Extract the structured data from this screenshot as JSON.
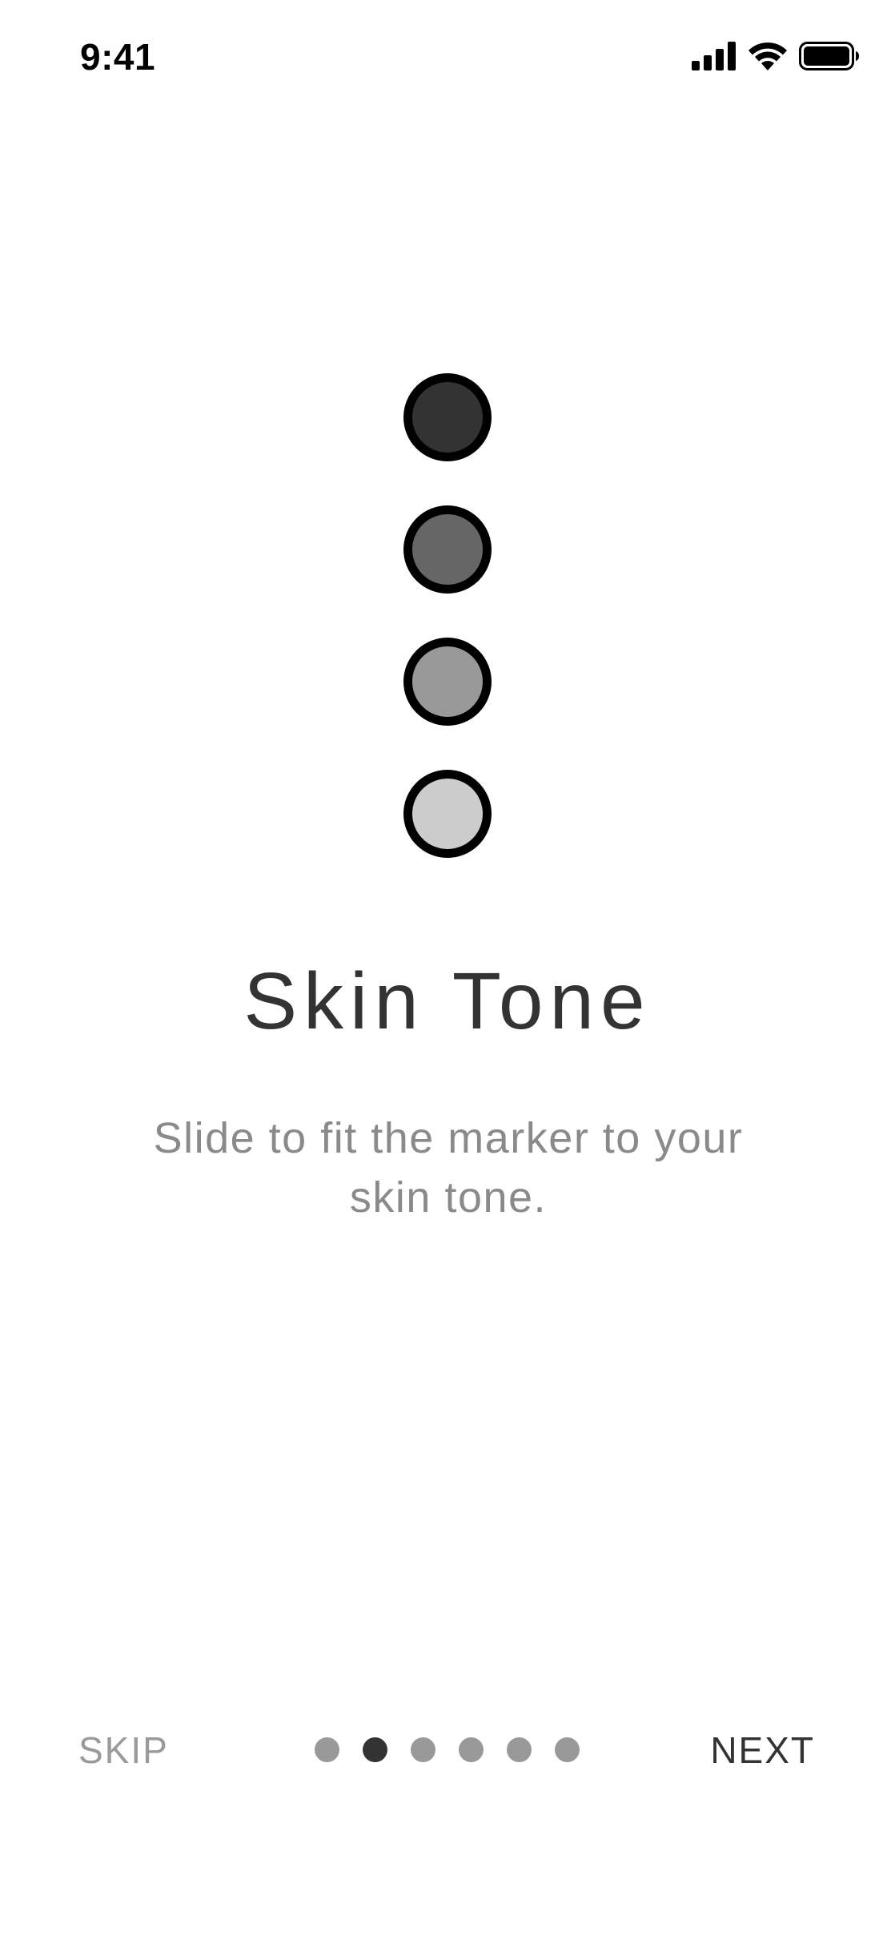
{
  "status_bar": {
    "time": "9:41",
    "icons": [
      "cellular-signal-icon",
      "wifi-icon",
      "battery-icon"
    ]
  },
  "tones": [
    {
      "name": "tone-1",
      "color": "#333333"
    },
    {
      "name": "tone-2",
      "color": "#666666"
    },
    {
      "name": "tone-3",
      "color": "#999999"
    },
    {
      "name": "tone-4",
      "color": "#cccccc"
    }
  ],
  "content": {
    "title": "Skin Tone",
    "subtitle": "Slide to fit the marker to your skin tone."
  },
  "navigation": {
    "skip_label": "SKIP",
    "next_label": "NEXT",
    "page_count": 6,
    "active_page": 2
  },
  "colors": {
    "text_dark": "#333333",
    "text_muted": "#8a8a8a",
    "dot_inactive": "#999999",
    "dot_active": "#333333",
    "swatch_border": "#000000"
  }
}
